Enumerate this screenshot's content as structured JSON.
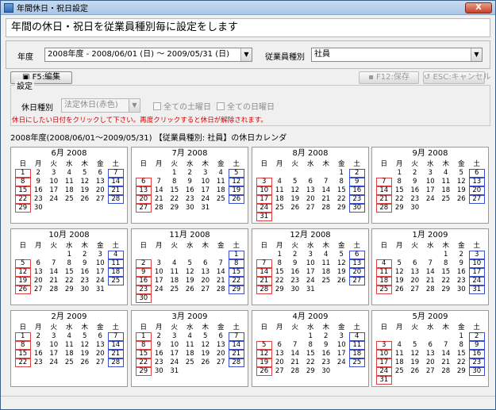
{
  "window": {
    "title": "年間休日・祝日設定",
    "close_label": "X"
  },
  "heading": "年間の休日・祝日を従業員種別毎に設定をします",
  "year": {
    "label": "年度",
    "value": "2008年度 - 2008/06/01 (日) ～ 2009/05/31 (日)"
  },
  "employee_type": {
    "label": "従業員種別",
    "value": "社員"
  },
  "toolbar": {
    "edit": "F5:編集",
    "save": "F12:保存",
    "cancel": "ESC:キャンセル"
  },
  "settings": {
    "title": "設定",
    "holiday_type_label": "休日種別",
    "holiday_type_value": "法定休日(赤色)",
    "all_saturdays": "全ての土曜日",
    "all_sundays": "全ての日曜日",
    "notice": "休日にしたい日付をクリックして下さい。再度クリックすると休日が解除されます。"
  },
  "calendar_title": "2008年度(2008/06/01～2009/05/31) 【従業員種別: 社員】の休日カレンダ",
  "weekdays": [
    "日",
    "月",
    "火",
    "水",
    "木",
    "金",
    "土"
  ],
  "months": [
    {
      "title": "6月 2008",
      "start": 0,
      "days": 30
    },
    {
      "title": "7月 2008",
      "start": 2,
      "days": 31
    },
    {
      "title": "8月 2008",
      "start": 5,
      "days": 31
    },
    {
      "title": "9月 2008",
      "start": 1,
      "days": 30
    },
    {
      "title": "10月 2008",
      "start": 3,
      "days": 31
    },
    {
      "title": "11月 2008",
      "start": 6,
      "days": 30
    },
    {
      "title": "12月 2008",
      "start": 1,
      "days": 31
    },
    {
      "title": "1月 2009",
      "start": 4,
      "days": 31
    },
    {
      "title": "2月 2009",
      "start": 0,
      "days": 28
    },
    {
      "title": "3月 2009",
      "start": 0,
      "days": 31
    },
    {
      "title": "4月 2009",
      "start": 3,
      "days": 30
    },
    {
      "title": "5月 2009",
      "start": 5,
      "days": 31
    }
  ],
  "colors": {
    "holiday_red": "#e04040",
    "saturday_blue": "#3a50d0",
    "notice_red": "#d00000"
  }
}
